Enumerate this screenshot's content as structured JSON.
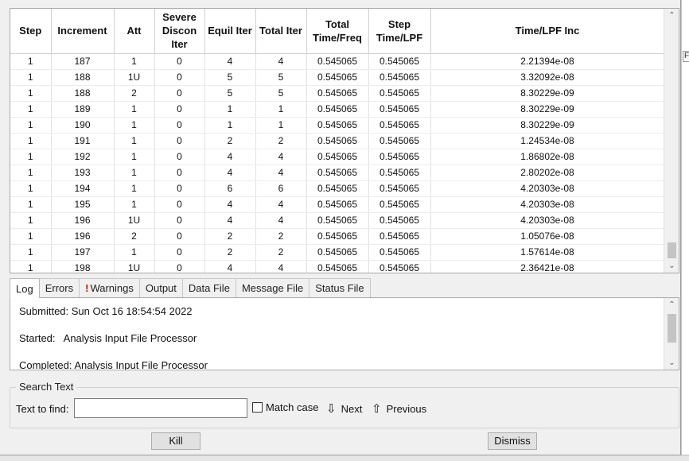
{
  "table": {
    "columns": [
      {
        "label": "Step"
      },
      {
        "label": "Increment"
      },
      {
        "label": "Att"
      },
      {
        "label": "Severe Discon Iter"
      },
      {
        "label": "Equil Iter"
      },
      {
        "label": "Total Iter"
      },
      {
        "label": "Total Time/Freq"
      },
      {
        "label": "Step Time/LPF"
      },
      {
        "label": "Time/LPF Inc"
      }
    ],
    "rows": [
      [
        "1",
        "187",
        "1",
        "0",
        "4",
        "4",
        "0.545065",
        "0.545065",
        "2.21394e-08"
      ],
      [
        "1",
        "188",
        "1U",
        "0",
        "5",
        "5",
        "0.545065",
        "0.545065",
        "3.32092e-08"
      ],
      [
        "1",
        "188",
        "2",
        "0",
        "5",
        "5",
        "0.545065",
        "0.545065",
        "8.30229e-09"
      ],
      [
        "1",
        "189",
        "1",
        "0",
        "1",
        "1",
        "0.545065",
        "0.545065",
        "8.30229e-09"
      ],
      [
        "1",
        "190",
        "1",
        "0",
        "1",
        "1",
        "0.545065",
        "0.545065",
        "8.30229e-09"
      ],
      [
        "1",
        "191",
        "1",
        "0",
        "2",
        "2",
        "0.545065",
        "0.545065",
        "1.24534e-08"
      ],
      [
        "1",
        "192",
        "1",
        "0",
        "4",
        "4",
        "0.545065",
        "0.545065",
        "1.86802e-08"
      ],
      [
        "1",
        "193",
        "1",
        "0",
        "4",
        "4",
        "0.545065",
        "0.545065",
        "2.80202e-08"
      ],
      [
        "1",
        "194",
        "1",
        "0",
        "6",
        "6",
        "0.545065",
        "0.545065",
        "4.20303e-08"
      ],
      [
        "1",
        "195",
        "1",
        "0",
        "4",
        "4",
        "0.545065",
        "0.545065",
        "4.20303e-08"
      ],
      [
        "1",
        "196",
        "1U",
        "0",
        "4",
        "4",
        "0.545065",
        "0.545065",
        "4.20303e-08"
      ],
      [
        "1",
        "196",
        "2",
        "0",
        "2",
        "2",
        "0.545065",
        "0.545065",
        "1.05076e-08"
      ],
      [
        "1",
        "197",
        "1",
        "0",
        "2",
        "2",
        "0.545065",
        "0.545065",
        "1.57614e-08"
      ],
      [
        "1",
        "198",
        "1U",
        "0",
        "4",
        "4",
        "0.545065",
        "0.545065",
        "2.36421e-08"
      ]
    ]
  },
  "tabs": [
    {
      "label": "Log",
      "active": true,
      "warning": false
    },
    {
      "label": "Errors",
      "active": false,
      "warning": false
    },
    {
      "label": "Warnings",
      "active": false,
      "warning": true
    },
    {
      "label": "Output",
      "active": false,
      "warning": false
    },
    {
      "label": "Data File",
      "active": false,
      "warning": false
    },
    {
      "label": "Message File",
      "active": false,
      "warning": false
    },
    {
      "label": "Status File",
      "active": false,
      "warning": false
    }
  ],
  "log": {
    "submitted": "Submitted: Sun Oct 16 18:54:54 2022",
    "started": "Started:   Analysis Input File Processor",
    "completed": "Completed: Analysis Input File Processor"
  },
  "search": {
    "group_label": "Search Text",
    "find_label": "Text to find:",
    "find_value": "",
    "match_case_label": "Match case",
    "match_case_checked": false,
    "next_label": "Next",
    "previous_label": "Previous"
  },
  "buttons": {
    "kill": "Kill",
    "dismiss": "Dismiss"
  },
  "background": {
    "right_fragment": "FF"
  },
  "colors": {
    "warning": "#dd0000",
    "panel": "#f0f0f0"
  }
}
